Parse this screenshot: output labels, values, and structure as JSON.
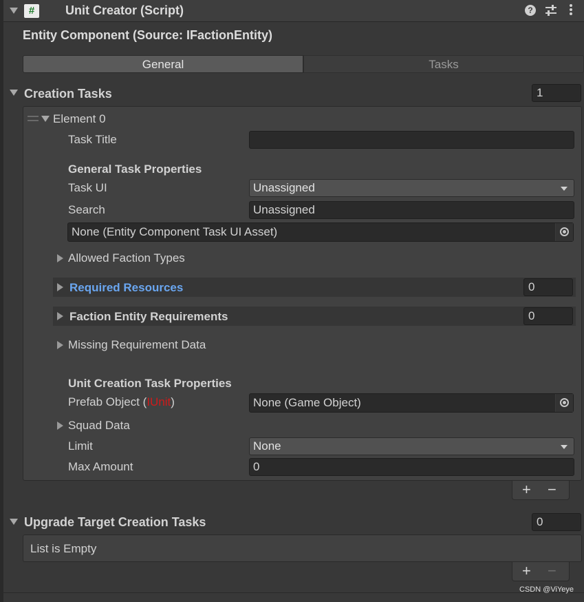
{
  "header": {
    "script_icon_glyph": "#",
    "title": "Unit Creator (Script)",
    "help_glyph": "?"
  },
  "component": {
    "title": "Entity Component (Source: IFactionEntity)"
  },
  "tabs": [
    {
      "label": "General",
      "selected": true
    },
    {
      "label": "Tasks",
      "selected": false
    }
  ],
  "creation_tasks": {
    "label": "Creation Tasks",
    "count": "1",
    "element": {
      "label": "Element 0",
      "task_title_label": "Task Title",
      "task_title_value": "",
      "general_header": "General Task Properties",
      "task_ui_label": "Task UI",
      "task_ui_value": "Unassigned",
      "search_label": "Search",
      "search_value": "Unassigned",
      "task_ui_asset_value": "None (Entity Component Task UI Asset)",
      "allowed_faction_types_label": "Allowed Faction Types",
      "required_resources_label": "Required Resources",
      "required_resources_count": "0",
      "faction_entity_requirements_label": "Faction Entity Requirements",
      "faction_entity_requirements_count": "0",
      "missing_requirement_label": "Missing Requirement Data",
      "unit_header": "Unit Creation Task Properties",
      "prefab_label_prefix": "Prefab Object (",
      "prefab_label_type": "IUnit",
      "prefab_label_suffix": ")",
      "prefab_value": "None (Game Object)",
      "squad_data_label": "Squad Data",
      "limit_label": "Limit",
      "limit_value": "None",
      "max_amount_label": "Max Amount",
      "max_amount_value": "0"
    },
    "add_glyph": "+",
    "remove_glyph": "−"
  },
  "upgrade_tasks": {
    "label": "Upgrade Target Creation Tasks",
    "count": "0",
    "empty_text": "List is Empty",
    "add_glyph": "+",
    "remove_glyph": "−"
  },
  "watermark": "CSDN @ViYeye",
  "colors": {
    "background": "#383838",
    "required_resources_text": "#6aa6f0",
    "error_type_text": "#d01a1a"
  }
}
